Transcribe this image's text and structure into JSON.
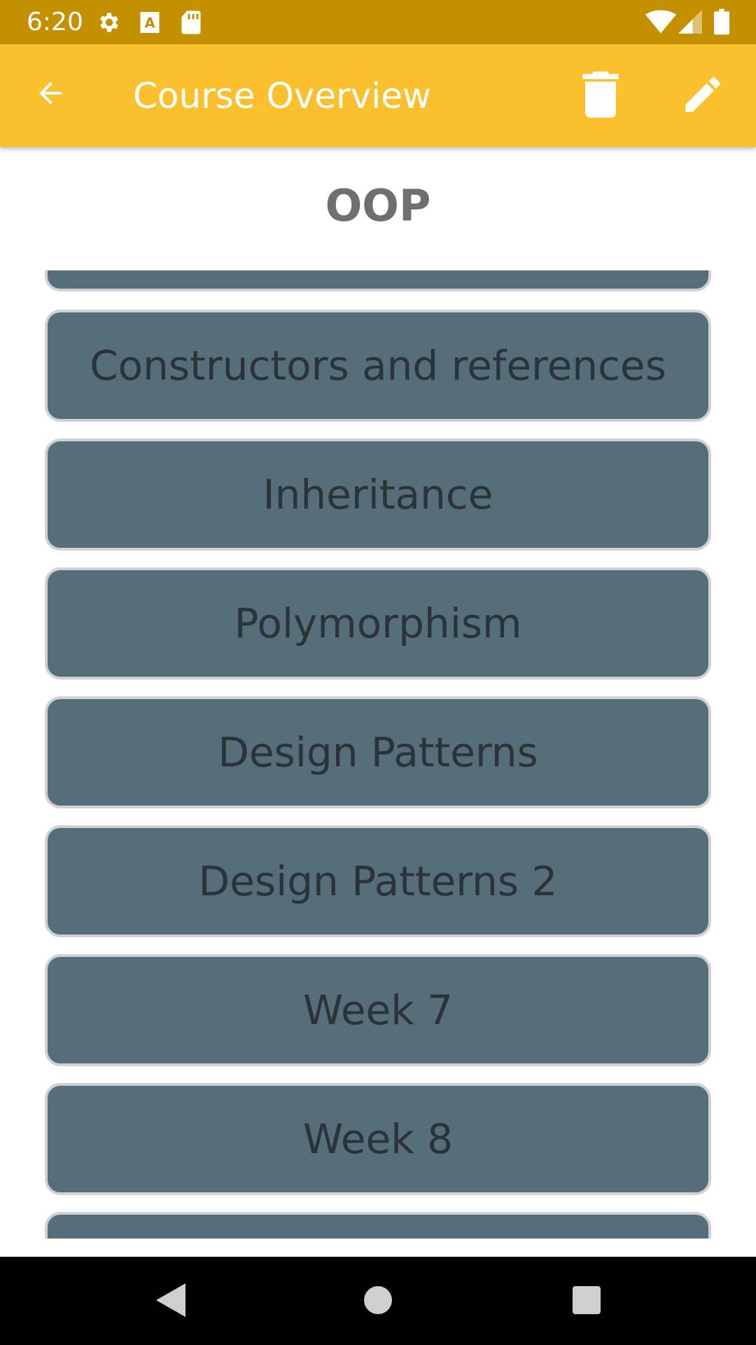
{
  "status_bar": {
    "time": "6:20",
    "icons": [
      "settings-icon",
      "text-icon",
      "sd-card-icon",
      "wifi-icon",
      "signal-icon",
      "battery-icon"
    ]
  },
  "app_bar": {
    "title": "Course Overview",
    "back_icon": "arrow-back-icon",
    "delete_icon": "trash-icon",
    "edit_icon": "pencil-icon",
    "background": "#fbc02d"
  },
  "course": {
    "name": "OOP"
  },
  "weeks": [
    {
      "label": ""
    },
    {
      "label": "Constructors and references"
    },
    {
      "label": "Inheritance"
    },
    {
      "label": "Polymorphism"
    },
    {
      "label": "Design Patterns"
    },
    {
      "label": "Design Patterns 2"
    },
    {
      "label": "Week 7"
    },
    {
      "label": "Week 8"
    },
    {
      "label": ""
    }
  ],
  "colors": {
    "status_bar": "#c49000",
    "item_fill": "#566e7a",
    "item_border": "#cfd2d4",
    "item_text": "#2a3338",
    "course_title": "#6f6f6f"
  },
  "nav_bar": {
    "back_icon": "nav-back-icon",
    "home_icon": "nav-home-icon",
    "recents_icon": "nav-recents-icon"
  }
}
